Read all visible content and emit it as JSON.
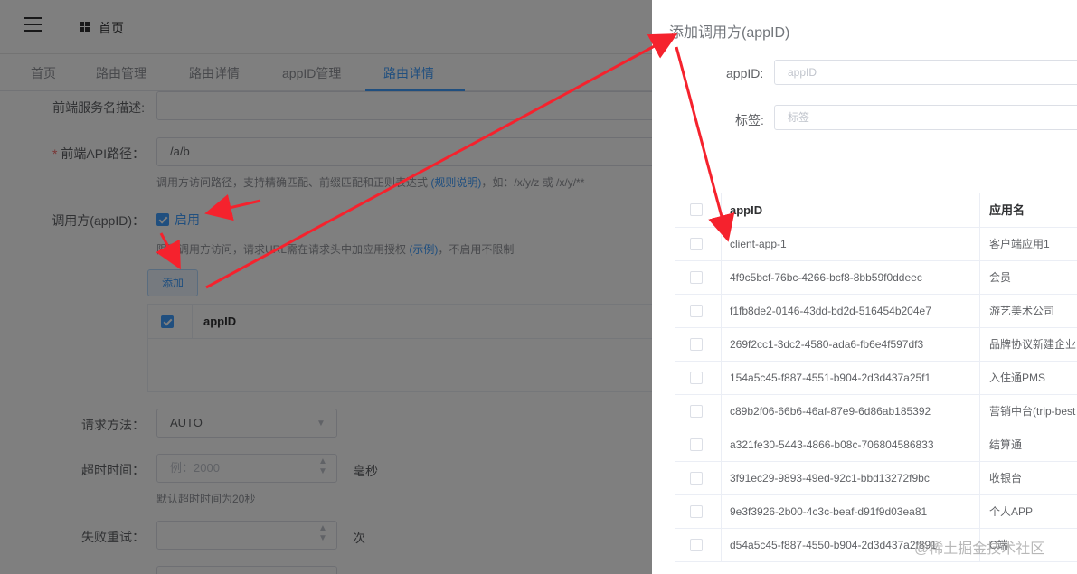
{
  "header": {
    "home_title": "首页"
  },
  "tabs": [
    {
      "label": "首页"
    },
    {
      "label": "路由管理"
    },
    {
      "label": "路由详情"
    },
    {
      "label": "appID管理"
    },
    {
      "label": "路由详情",
      "close": "×"
    }
  ],
  "form": {
    "service_desc_label": "前端服务名描述:",
    "api_path_label": "前端API路径：",
    "api_path_required": "*",
    "api_path_value": "/a/b",
    "api_path_hint_pre": "调用方访问路径，支持精确匹配、前缀匹配和正则表达式",
    "api_path_hint_link": "(规则说明)",
    "api_path_hint_post": "，如：/x/y/z 或 /x/y/**",
    "caller_label": "调用方(appID)：",
    "caller_enable": "启用",
    "caller_hint_pre": "限制调用方访问，请求URL需在请求头中加应用授权",
    "caller_hint_link": "(示例)",
    "caller_hint_post": "，不启用不限制",
    "add_button": "添加",
    "mini_table_header": "appID",
    "method_label": "请求方法：",
    "method_value": "AUTO",
    "timeout_label": "超时时间：",
    "timeout_placeholder": "例：2000",
    "timeout_unit": "毫秒",
    "timeout_hint": "默认超时时间为20秒",
    "retry_label": "失败重试：",
    "retry_unit": "次"
  },
  "drawer": {
    "title": "添加调用方(appID)",
    "appid_label": "appID:",
    "appid_placeholder": "appID",
    "tag_label": "标签:",
    "tag_placeholder": "标签",
    "table": {
      "col_appid": "appID",
      "col_appname": "应用名",
      "rows": [
        {
          "appid": "client-app-1",
          "name": "客户端应用1"
        },
        {
          "appid": "4f9c5bcf-76bc-4266-bcf8-8bb59f0ddeec",
          "name": "会员"
        },
        {
          "appid": "f1fb8de2-0146-43dd-bd2d-516454b204e7",
          "name": "游艺美术公司"
        },
        {
          "appid": "269f2cc1-3dc2-4580-ada6-fb6e4f597df3",
          "name": "品牌协议新建企业"
        },
        {
          "appid": "154a5c45-f887-4551-b904-2d3d437a25f1",
          "name": "入住通PMS"
        },
        {
          "appid": "c89b2f06-66b6-46af-87e9-6d86ab185392",
          "name": "营销中台(trip-best"
        },
        {
          "appid": "a321fe30-5443-4866-b08c-706804586833",
          "name": "结算通"
        },
        {
          "appid": "3f91ec29-9893-49ed-92c1-bbd13272f9bc",
          "name": "收银台"
        },
        {
          "appid": "9e3f3926-2b00-4c3c-beaf-d91f9d03ea81",
          "name": "个人APP"
        },
        {
          "appid": "d54a5c45-f887-4550-b904-2d3d437a2f891",
          "name": "C端"
        }
      ]
    }
  },
  "watermark": "@稀土掘金技术社区",
  "colors": {
    "primary": "#409eff",
    "arrow": "#f5222d",
    "mask": "rgba(0,0,0,0.5)"
  }
}
